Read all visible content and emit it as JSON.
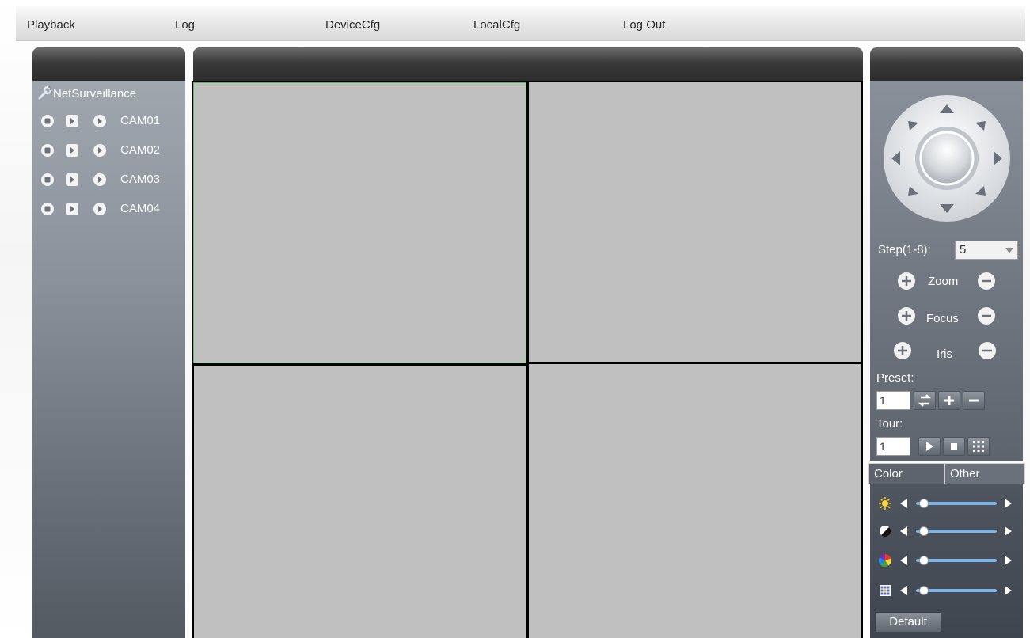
{
  "menu": {
    "items": [
      "Playback",
      "Log",
      "DeviceCfg",
      "LocalCfg",
      "Log Out"
    ]
  },
  "device_tree": {
    "root_label": "NetSurveillance",
    "cameras": [
      "CAM01",
      "CAM02",
      "CAM03",
      "CAM04"
    ]
  },
  "video_grid": {
    "layout": "2x2",
    "selected_cell": 1
  },
  "ptz": {
    "step_label": "Step(1-8):",
    "step_value": "5",
    "zoom_label": "Zoom",
    "focus_label": "Focus",
    "iris_label": "Iris",
    "preset_label": "Preset:",
    "preset_value": "1",
    "tour_label": "Tour:",
    "tour_value": "1"
  },
  "color_panel": {
    "tabs": [
      "Color",
      "Other"
    ],
    "active_tab": "Color",
    "sliders": [
      {
        "icon": "brightness-icon",
        "level": 0.0
      },
      {
        "icon": "contrast-icon",
        "level": 0.0
      },
      {
        "icon": "saturation-icon",
        "level": 0.0
      },
      {
        "icon": "hue-icon",
        "level": 0.0
      }
    ],
    "default_label": "Default"
  },
  "colors": {
    "selected_cell_border": "#5cb85c",
    "video_cell": "#c0c0c0",
    "slider_track": "#7fb3e6"
  }
}
